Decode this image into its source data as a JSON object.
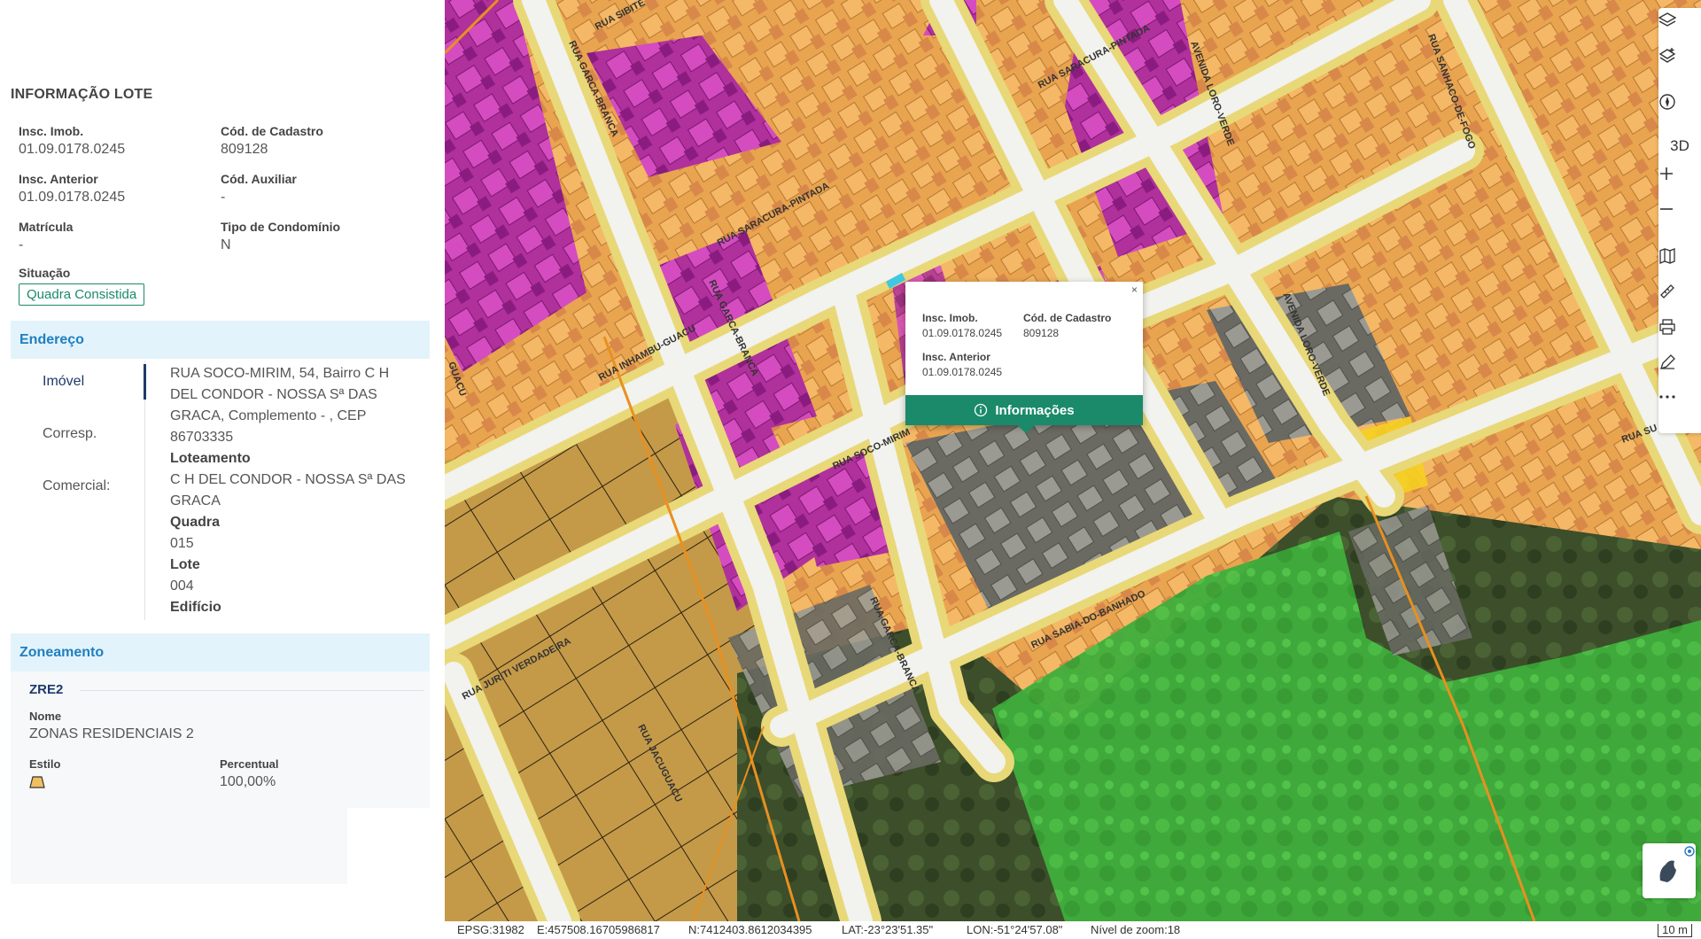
{
  "panel": {
    "title": "INFORMAÇÃO LOTE",
    "fields": {
      "insc_imob": {
        "label": "Insc. Imob.",
        "value": "01.09.0178.0245"
      },
      "cod_cadastro": {
        "label": "Cód. de Cadastro",
        "value": "809128"
      },
      "insc_anterior": {
        "label": "Insc. Anterior",
        "value": "01.09.0178.0245"
      },
      "cod_auxiliar": {
        "label": "Cód. Auxiliar",
        "value": "-"
      },
      "matricula": {
        "label": "Matrícula",
        "value": "-"
      },
      "tipo_condominio": {
        "label": "Tipo de Condomínio",
        "value": "N"
      },
      "situacao": {
        "label": "Situação",
        "value": "Quadra Consistida"
      }
    },
    "endereco": {
      "section_title": "Endereço",
      "tabs": [
        "Imóvel",
        "Corresp.",
        "Comercial:"
      ],
      "address_lines": [
        "RUA SOCO-MIRIM, 54, Bairro C H",
        "DEL CONDOR - NOSSA Sª DAS",
        "GRACA, Complemento - , CEP",
        "86703335"
      ],
      "loteamento_label": "Loteamento",
      "loteamento_lines": [
        "C H DEL CONDOR - NOSSA Sª DAS",
        "GRACA"
      ],
      "quadra_label": "Quadra",
      "quadra_value": "015",
      "lote_label": "Lote",
      "lote_value": "004",
      "edificio_label": "Edifício"
    },
    "zoneamento": {
      "section_title": "Zoneamento",
      "code": "ZRE2",
      "nome_label": "Nome",
      "nome_value": "ZONAS RESIDENCIAIS 2",
      "estilo_label": "Estilo",
      "percentual_label": "Percentual",
      "percentual_value": "100,00%"
    }
  },
  "map": {
    "streets": [
      "RUA SIBITE",
      "RUA GARCA-BRANCA",
      "RUA SARACURA-PINTADA",
      "AVENIDA LORO-VERDE",
      "RUA SANHACO-DE-FOGO",
      "RUA INHAMBU-GUACU",
      "RUA SOCO-MIRIM",
      "RUA SABIA-DO-BANHADO",
      "RUA JURITI VERDADEIRA",
      "RUA JACUGUACU",
      "GUACU",
      "RUA SU"
    ],
    "toolbar": [
      {
        "icon": "layers-icon"
      },
      {
        "icon": "layers-add-icon"
      },
      {
        "icon": "compass-icon"
      },
      {
        "icon": "3d-toggle",
        "label": "3D"
      },
      {
        "icon": "zoom-in-icon"
      },
      {
        "icon": "zoom-out-icon"
      },
      {
        "icon": "basemap-icon"
      },
      {
        "icon": "ruler-icon"
      },
      {
        "icon": "print-icon"
      },
      {
        "icon": "draw-icon"
      },
      {
        "icon": "more-icon"
      }
    ],
    "popup": {
      "close": "×",
      "insc_imob_label": "Insc. Imob.",
      "insc_imob_value": "01.09.0178.0245",
      "cod_cadastro_label": "Cód. de Cadastro",
      "cod_cadastro_value": "809128",
      "insc_anterior_label": "Insc. Anterior",
      "insc_anterior_value": "01.09.0178.0245",
      "button_label": "Informações"
    },
    "colors": {
      "residential": "#f0a848",
      "commercial": "#c030b0",
      "road": "#f0f0f0",
      "road_border": "#e6d470",
      "green_area": "#40c040",
      "selected_lot": "#f5d020",
      "accent": "#1a8a6a"
    }
  },
  "statusbar": {
    "epsg": "EPSG:31982",
    "easting": "E:457508.16705986817",
    "northing": "N:7412403.8612034395",
    "lat": "LAT:-23°23'51.35\"",
    "lon": "LON:-51°24'57.08\"",
    "zoom": "Nível de zoom:18",
    "scale": "10 m"
  }
}
